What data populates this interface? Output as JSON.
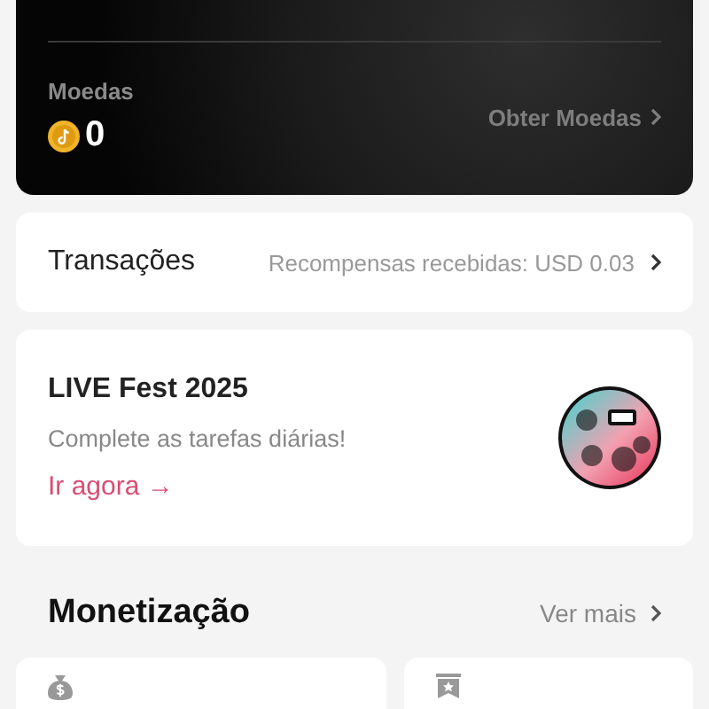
{
  "coins": {
    "label": "Moedas",
    "amount": "0",
    "action": "Obter Moedas"
  },
  "transactions": {
    "title": "Transações",
    "summary": "Recompensas recebidas: USD 0.03"
  },
  "promo": {
    "title": "LIVE Fest 2025",
    "subtitle": "Complete as tarefas diárias!",
    "link": "Ir agora →"
  },
  "monetization": {
    "title": "Monetização",
    "more": "Ver mais"
  }
}
